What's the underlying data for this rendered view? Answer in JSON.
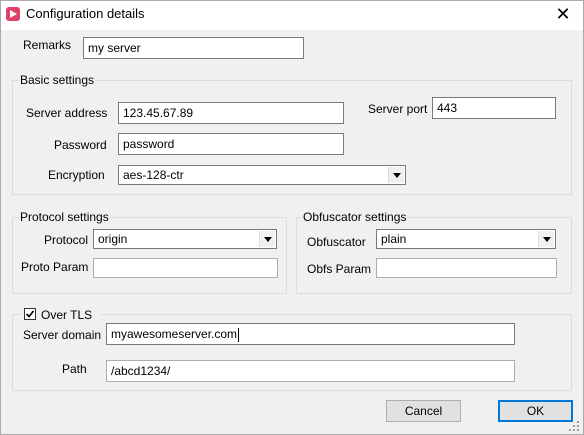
{
  "window": {
    "title": "Configuration details",
    "close_glyph": "✕",
    "accent": "#e0406a"
  },
  "remarks": {
    "label": "Remarks",
    "value": "my server"
  },
  "basic": {
    "legend": "Basic settings",
    "server_address_label": "Server address",
    "server_address_value": "123.45.67.89",
    "server_port_label": "Server port",
    "server_port_value": "443",
    "password_label": "Password",
    "password_value": "password",
    "encryption_label": "Encryption",
    "encryption_value": "aes-128-ctr"
  },
  "protocol": {
    "legend": "Protocol settings",
    "protocol_label": "Protocol",
    "protocol_value": "origin",
    "proto_param_label": "Proto Param",
    "proto_param_value": ""
  },
  "obfuscator": {
    "legend": "Obfuscator settings",
    "obfs_label": "Obfuscator",
    "obfs_value": "plain",
    "obfs_param_label": "Obfs Param",
    "obfs_param_value": ""
  },
  "tls": {
    "checkbox_label": "Over TLS",
    "checked": true,
    "server_domain_label": "Server domain",
    "server_domain_value": "myawesomeserver.com",
    "path_label": "Path",
    "path_value": "/abcd1234/"
  },
  "buttons": {
    "cancel": "Cancel",
    "ok": "OK"
  },
  "icons": {
    "app": "app-logo-icon",
    "dropdown": "chevron-down-icon",
    "check": "check-icon",
    "grip": "resize-grip-icon"
  }
}
